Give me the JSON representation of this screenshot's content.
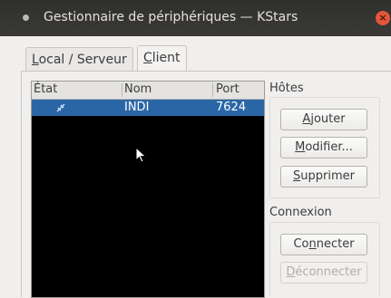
{
  "window": {
    "title": "Gestionnaire de périphériques — KStars",
    "close_glyph": "×"
  },
  "tabs": [
    {
      "pre": "",
      "key": "L",
      "post": "ocal / Serveur",
      "active": false
    },
    {
      "pre": "",
      "key": "C",
      "post": "lient",
      "active": true
    }
  ],
  "devices": {
    "columns": [
      "État",
      "Nom",
      "Port"
    ],
    "rows": [
      {
        "status_icon": "connection-icon",
        "name": "INDI",
        "port": "7624",
        "selected": true
      }
    ]
  },
  "hosts": {
    "label": "Hôtes",
    "add": {
      "pre": "",
      "key": "A",
      "post": "jouter"
    },
    "modify": {
      "pre": "",
      "key": "M",
      "post": "odifier..."
    },
    "delete": {
      "pre": "",
      "key": "S",
      "post": "upprimer"
    }
  },
  "connection": {
    "label": "Connexion",
    "connect": {
      "pre": "Co",
      "key": "n",
      "post": "necter"
    },
    "disconnect": {
      "pre": "",
      "key": "D",
      "post": "éconnecter",
      "disabled": true
    }
  },
  "colors": {
    "selection": "#2a66a6",
    "titlebar": "#3b3a37",
    "close": "#e6563a"
  }
}
